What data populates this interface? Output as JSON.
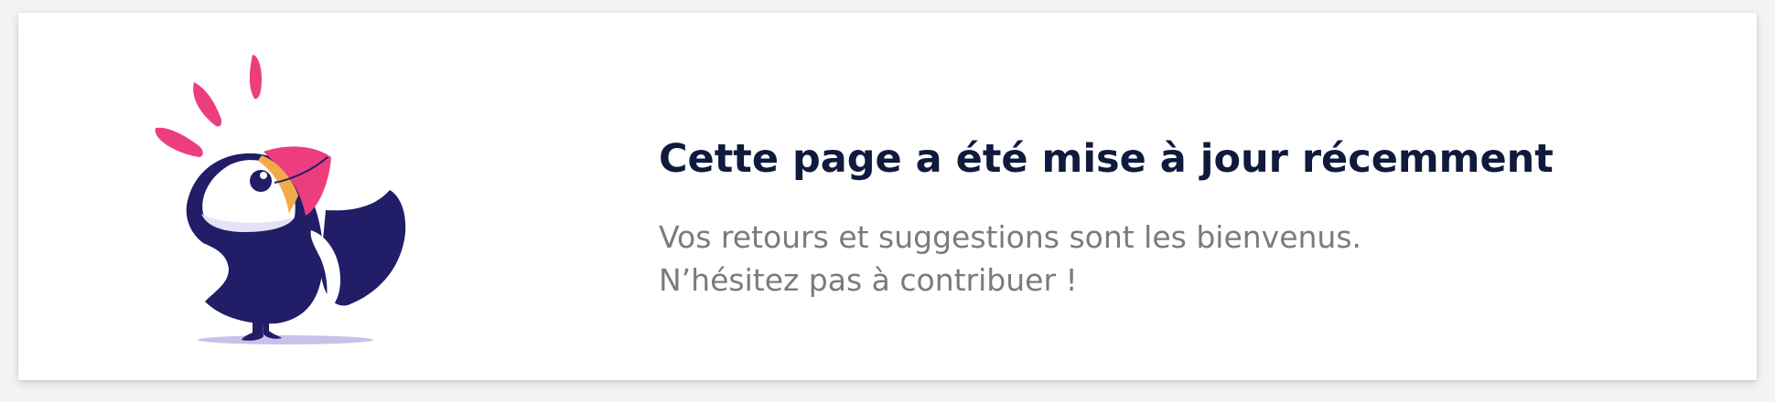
{
  "banner": {
    "title": "Cette page a été mise à jour récemment",
    "message_line_1": "Vos retours et suggestions sont les bienvenus.",
    "message_line_2": "N’hésitez pas à contribuer !"
  },
  "illustration": {
    "icon": "puffin-icon",
    "colors": {
      "body": "#211d67",
      "beak_pink": "#ec3e7e",
      "beak_orange": "#f1ab4a",
      "face": "#e4e2f4",
      "shadow": "#c6c2e8",
      "exclamation": "#ec3e7e"
    }
  },
  "colors": {
    "title": "#0f1a3c",
    "message": "#7a7a7f",
    "card_background": "#ffffff",
    "page_background": "#f4f4f6"
  }
}
